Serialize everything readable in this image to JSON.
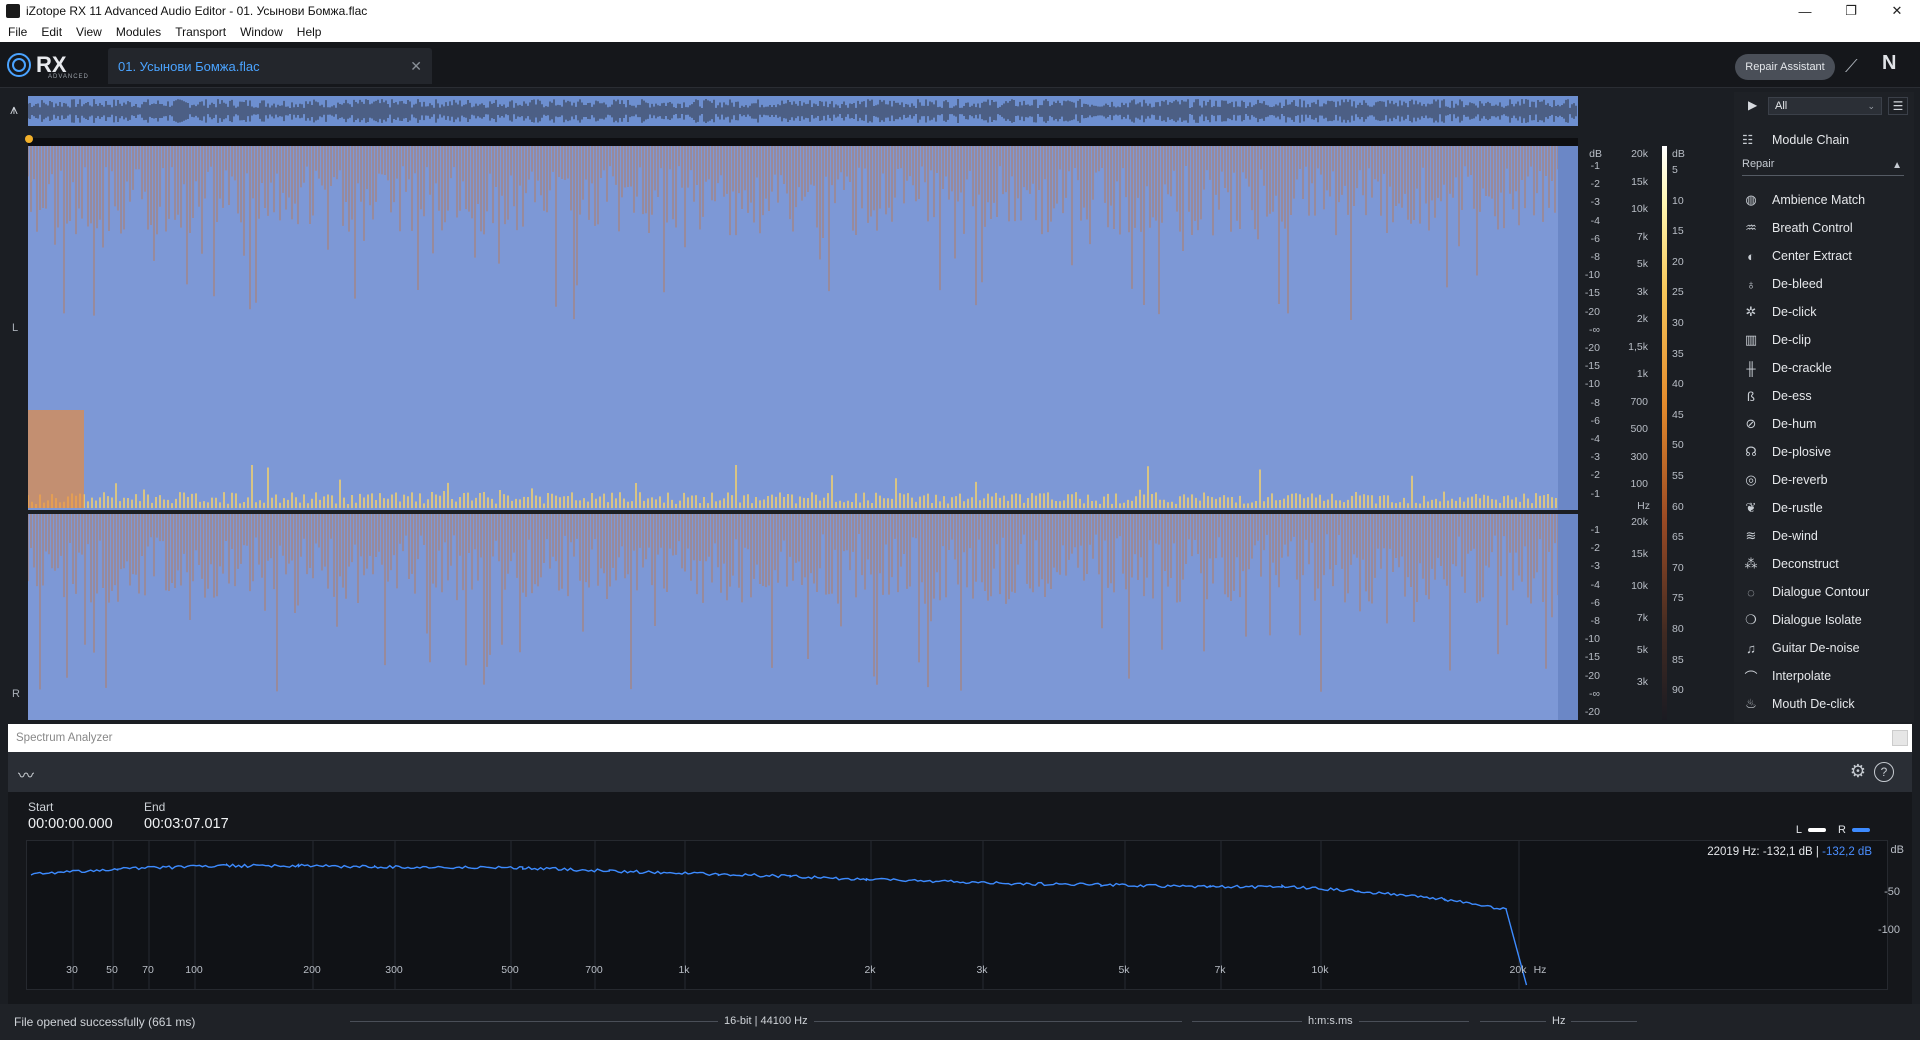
{
  "window": {
    "title": "iZotope RX 11 Advanced Audio Editor - 01. Усынови Бомжа.flac",
    "controls": [
      "—",
      "❐",
      "✕"
    ]
  },
  "menu": [
    "File",
    "Edit",
    "View",
    "Modules",
    "Transport",
    "Window",
    "Help"
  ],
  "header": {
    "logo": "RX",
    "logo_sub": "ADVANCED",
    "file_tab": "01. Усынови Бомжа.flac",
    "repair_assistant": "Repair Assistant"
  },
  "spectrogram": {
    "channels": [
      "L",
      "R"
    ],
    "db_label": "dB",
    "hz_label": "Hz",
    "db_ticks_l": [
      "-1",
      "-2",
      "-3",
      "-4",
      "-6",
      "-8",
      "-10",
      "-15",
      "-20",
      "-∞",
      "-20",
      "-15",
      "-10",
      "-8",
      "-6",
      "-4",
      "-3",
      "-2",
      "-1"
    ],
    "hz_ticks_l": [
      "20k",
      "15k",
      "10k",
      "7k",
      "5k",
      "3k",
      "2k",
      "1,5k",
      "1k",
      "700",
      "500",
      "300",
      "100"
    ],
    "db_ticks_r": [
      "-1",
      "-2",
      "-3",
      "-4",
      "-6",
      "-8",
      "-10",
      "-15",
      "-20",
      "-∞",
      "-20"
    ],
    "hz_ticks_r": [
      "20k",
      "15k",
      "10k",
      "7k",
      "5k",
      "3k"
    ],
    "colorbar_ticks": [
      "5",
      "10",
      "15",
      "20",
      "25",
      "30",
      "35",
      "40",
      "45",
      "50",
      "55",
      "60",
      "65",
      "70",
      "75",
      "80",
      "85",
      "90"
    ]
  },
  "modules": {
    "filter": "All",
    "chain": "Module Chain",
    "section": "Repair",
    "items": [
      {
        "label": "Ambience Match",
        "icon": "ambience-match-icon",
        "glyph": "◍"
      },
      {
        "label": "Breath Control",
        "icon": "breath-control-icon",
        "glyph": "♒"
      },
      {
        "label": "Center Extract",
        "icon": "center-extract-icon",
        "glyph": "◐"
      },
      {
        "label": "De-bleed",
        "icon": "de-bleed-icon",
        "glyph": "♁"
      },
      {
        "label": "De-click",
        "icon": "de-click-icon",
        "glyph": "✲"
      },
      {
        "label": "De-clip",
        "icon": "de-clip-icon",
        "glyph": "▥"
      },
      {
        "label": "De-crackle",
        "icon": "de-crackle-icon",
        "glyph": "╫"
      },
      {
        "label": "De-ess",
        "icon": "de-ess-icon",
        "glyph": "ß"
      },
      {
        "label": "De-hum",
        "icon": "de-hum-icon",
        "glyph": "⊘"
      },
      {
        "label": "De-plosive",
        "icon": "de-plosive-icon",
        "glyph": "☊"
      },
      {
        "label": "De-reverb",
        "icon": "de-reverb-icon",
        "glyph": "◎"
      },
      {
        "label": "De-rustle",
        "icon": "de-rustle-icon",
        "glyph": "❦"
      },
      {
        "label": "De-wind",
        "icon": "de-wind-icon",
        "glyph": "≋"
      },
      {
        "label": "Deconstruct",
        "icon": "deconstruct-icon",
        "glyph": "⁂"
      },
      {
        "label": "Dialogue Contour",
        "icon": "dialogue-contour-icon",
        "glyph": "◌"
      },
      {
        "label": "Dialogue Isolate",
        "icon": "dialogue-isolate-icon",
        "glyph": "❍"
      },
      {
        "label": "Guitar De-noise",
        "icon": "guitar-de-noise-icon",
        "glyph": "♫"
      },
      {
        "label": "Interpolate",
        "icon": "interpolate-icon",
        "glyph": "⌒"
      },
      {
        "label": "Mouth De-click",
        "icon": "mouth-de-click-icon",
        "glyph": "♨"
      }
    ]
  },
  "analyzer": {
    "title": "Spectrum Analyzer",
    "start_label": "Start",
    "start_value": "00:00:00.000",
    "end_label": "End",
    "end_value": "00:03:07.017",
    "legend_l": "L",
    "legend_r": "R",
    "color_l": "#ffffff",
    "color_r": "#3d8bff",
    "readout_freq": "22019 Hz:",
    "readout_l": "-132,1 dB",
    "readout_sep": "|",
    "readout_r": "-132,2 dB",
    "db_unit": "dB",
    "db_ticks": [
      "-50",
      "-100"
    ],
    "hz_ticks": [
      "30",
      "50",
      "70",
      "100",
      "200",
      "300",
      "500",
      "700",
      "1k",
      "2k",
      "3k",
      "5k",
      "7k",
      "10k",
      "20k",
      "Hz"
    ]
  },
  "chart_data": {
    "type": "line",
    "xlabel": "Hz",
    "ylabel": "dB",
    "x_scale": "log",
    "xlim": [
      20,
      22050
    ],
    "ylim": [
      -130,
      0
    ],
    "series": [
      {
        "name": "R",
        "x": [
          20,
          30,
          50,
          70,
          100,
          200,
          300,
          500,
          700,
          1000,
          2000,
          3000,
          5000,
          7000,
          10000,
          15000,
          20000,
          22000
        ],
        "y": [
          -26,
          -21,
          -18,
          -18,
          -19,
          -20,
          -23,
          -26,
          -28,
          -31,
          -35,
          -36,
          -38,
          -38,
          -42,
          -50,
          -60,
          -132
        ]
      }
    ]
  },
  "status": {
    "message": "File opened successfully (661 ms)",
    "format": "16-bit | 44100 Hz",
    "time_format": "h:m:s.ms",
    "freq_unit": "Hz"
  }
}
